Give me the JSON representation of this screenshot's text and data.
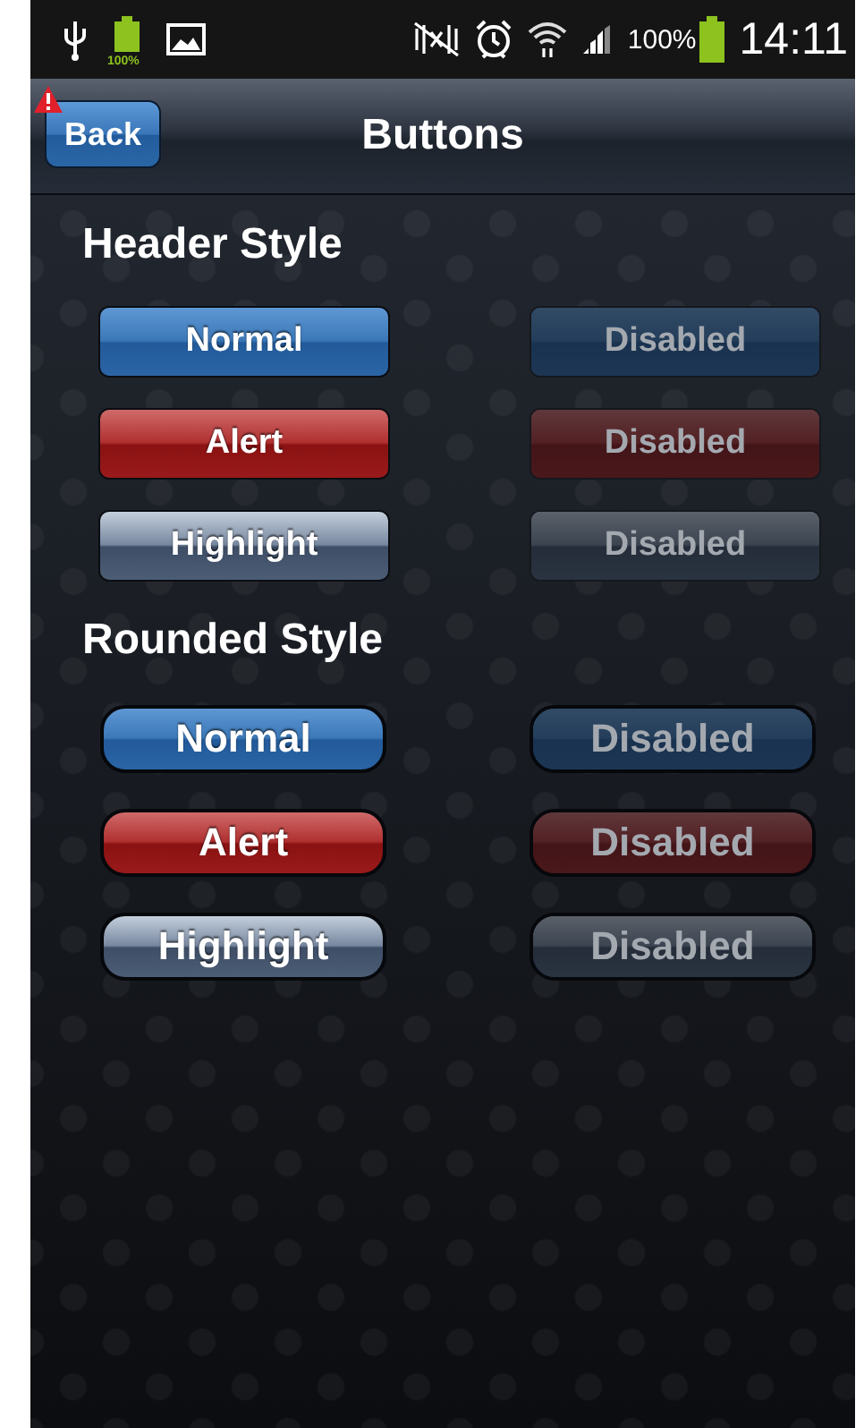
{
  "status_bar": {
    "battery_badge": "100%",
    "battery_percent": "100%",
    "time": "14:11"
  },
  "header": {
    "back_button": "Back",
    "back_alert": true,
    "title": "Buttons"
  },
  "sections": [
    {
      "title": "Header Style",
      "kind": "header",
      "rows": [
        [
          {
            "label": "Normal",
            "kind": "normal",
            "disabled": false
          },
          {
            "label": "Disabled",
            "kind": "normal",
            "disabled": true
          }
        ],
        [
          {
            "label": "Alert",
            "kind": "alert",
            "disabled": false
          },
          {
            "label": "Disabled",
            "kind": "alert",
            "disabled": true
          }
        ],
        [
          {
            "label": "Highlight",
            "kind": "highlight",
            "disabled": false
          },
          {
            "label": "Disabled",
            "kind": "highlight",
            "disabled": true
          }
        ]
      ]
    },
    {
      "title": "Rounded Style",
      "kind": "rounded",
      "rows": [
        [
          {
            "label": "Normal",
            "kind": "normal",
            "disabled": false
          },
          {
            "label": "Disabled",
            "kind": "normal",
            "disabled": true
          }
        ],
        [
          {
            "label": "Alert",
            "kind": "alert",
            "disabled": false
          },
          {
            "label": "Disabled",
            "kind": "alert",
            "disabled": true
          }
        ],
        [
          {
            "label": "Highlight",
            "kind": "highlight",
            "disabled": false
          },
          {
            "label": "Disabled",
            "kind": "highlight",
            "disabled": true
          }
        ]
      ]
    }
  ]
}
